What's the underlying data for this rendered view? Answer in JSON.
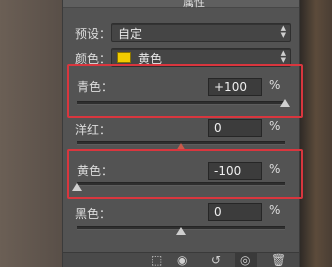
{
  "panel": {
    "title": "属性"
  },
  "preset": {
    "label": "预设：",
    "value": "自定"
  },
  "colors": {
    "label": "颜色：",
    "value": "黄色",
    "swatch_color": "#f2cc00"
  },
  "sliders": [
    {
      "label": "青色：",
      "value": "+100",
      "unit": "%",
      "level_percent": 100
    },
    {
      "label": "洋红：",
      "value": "0",
      "unit": "%",
      "level_percent": 50
    },
    {
      "label": "黄色：",
      "value": "-100",
      "unit": "%",
      "level_percent": 0
    },
    {
      "label": "黑色：",
      "value": "0",
      "unit": "%",
      "level_percent": 50
    }
  ],
  "highlight_color": "#d9363e",
  "bottom_toolbar": {
    "icons": [
      "clip-to-layer-icon",
      "view-previous-state-icon",
      "reset-icon",
      "toggle-visibility-icon",
      "delete-icon"
    ]
  }
}
